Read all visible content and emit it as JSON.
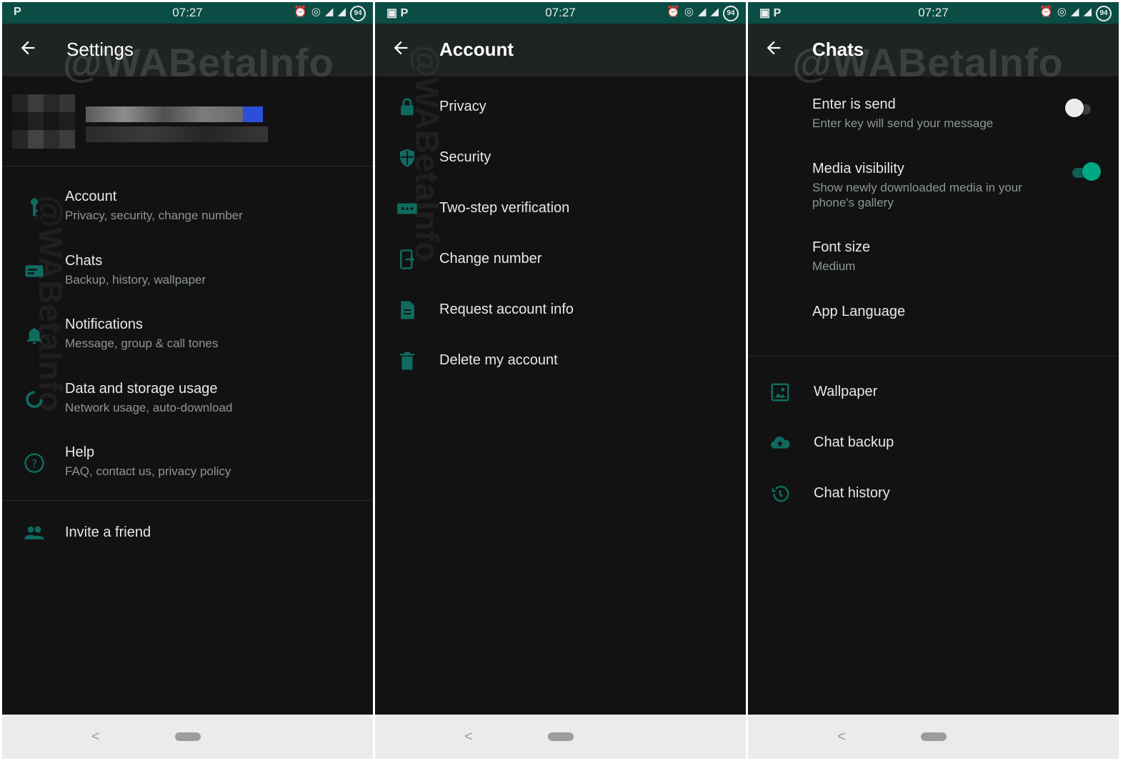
{
  "colors": {
    "status_bar": "#0b4d45",
    "app_bar": "#1f2323",
    "background": "#121212",
    "accent": "#00a884",
    "icon": "#0f6b5f",
    "nav_bar": "#ebebeb"
  },
  "watermark": "@WABetaInfo",
  "panels": [
    {
      "status": {
        "time": "07:27",
        "battery": "94"
      },
      "title": "Settings",
      "items": [
        {
          "title": "Account",
          "subtitle": "Privacy, security, change number",
          "icon": "key-icon"
        },
        {
          "title": "Chats",
          "subtitle": "Backup, history, wallpaper",
          "icon": "chat-icon"
        },
        {
          "title": "Notifications",
          "subtitle": "Message, group & call tones",
          "icon": "bell-icon"
        },
        {
          "title": "Data and storage usage",
          "subtitle": "Network usage, auto-download",
          "icon": "data-usage-icon"
        },
        {
          "title": "Help",
          "subtitle": "FAQ, contact us, privacy policy",
          "icon": "help-icon"
        }
      ],
      "invite": {
        "title": "Invite a friend",
        "icon": "people-icon"
      }
    },
    {
      "status": {
        "time": "07:27",
        "battery": "94"
      },
      "title": "Account",
      "items": [
        {
          "title": "Privacy",
          "icon": "lock-icon"
        },
        {
          "title": "Security",
          "icon": "shield-icon"
        },
        {
          "title": "Two-step verification",
          "icon": "dots-password-icon"
        },
        {
          "title": "Change number",
          "icon": "change-number-icon"
        },
        {
          "title": "Request account info",
          "icon": "document-icon"
        },
        {
          "title": "Delete my account",
          "icon": "trash-icon"
        }
      ]
    },
    {
      "status": {
        "time": "07:27",
        "battery": "94"
      },
      "title": "Chats",
      "settings": [
        {
          "title": "Enter is send",
          "subtitle": "Enter key will send your message",
          "toggle": false
        },
        {
          "title": "Media visibility",
          "subtitle_line1": "Show newly downloaded media in your",
          "subtitle_line2": "phone's gallery",
          "toggle": true
        },
        {
          "title": "Font size",
          "subtitle": "Medium"
        },
        {
          "title": "App Language"
        }
      ],
      "items": [
        {
          "title": "Wallpaper",
          "icon": "wallpaper-icon"
        },
        {
          "title": "Chat backup",
          "icon": "cloud-upload-icon"
        },
        {
          "title": "Chat history",
          "icon": "history-icon"
        }
      ]
    }
  ]
}
